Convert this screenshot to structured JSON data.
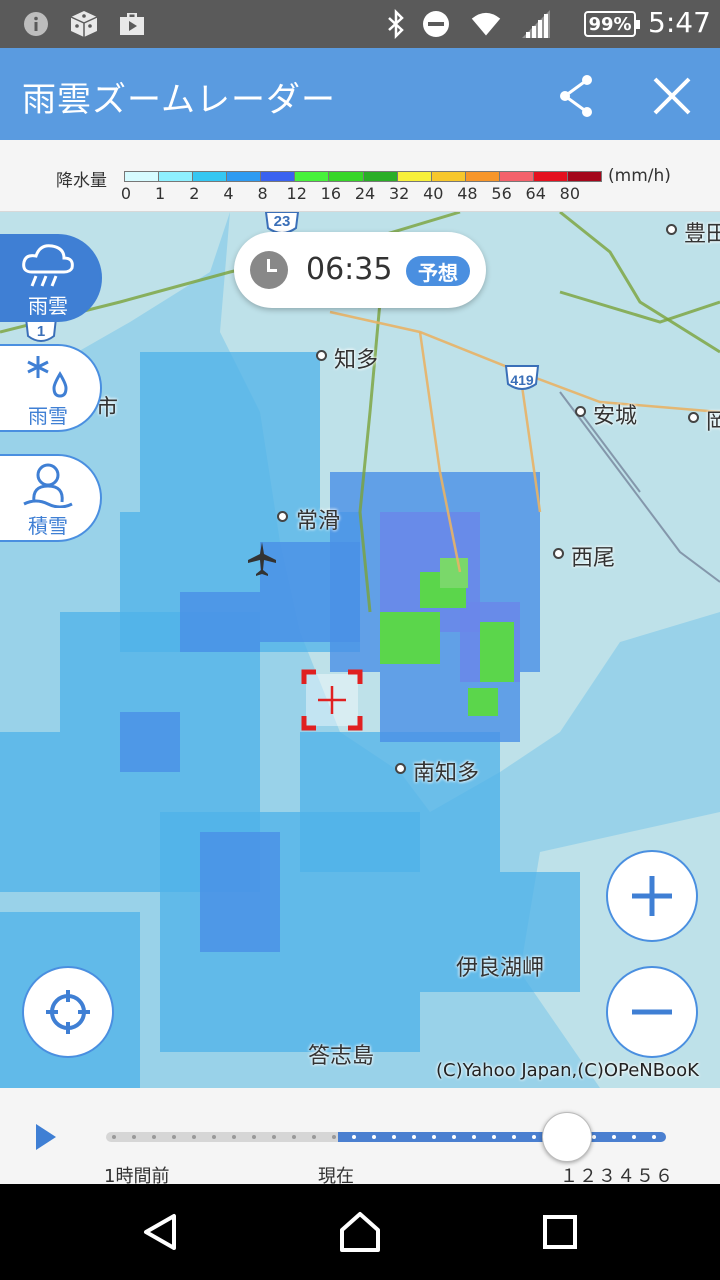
{
  "status_bar": {
    "icons": [
      "info-icon",
      "dice-icon",
      "play-store-icon",
      "bluetooth-icon",
      "do-not-disturb-icon",
      "wifi-icon",
      "signal-icon"
    ],
    "battery": "99%",
    "time": "5:47"
  },
  "app_bar": {
    "title": "雨雲ズームレーダー",
    "icons": [
      "share-icon",
      "close-icon"
    ]
  },
  "legend": {
    "label": "降水量",
    "ticks": [
      "0",
      "1",
      "2",
      "4",
      "8",
      "12",
      "16",
      "24",
      "32",
      "40",
      "48",
      "56",
      "64",
      "80"
    ],
    "unit": "(mm/h)",
    "colors": [
      "#d6fbff",
      "#8ef0ff",
      "#35c7f2",
      "#2e9bf2",
      "#3a62f0",
      "#47f23c",
      "#37d629",
      "#2aae27",
      "#f7f03a",
      "#f7c72c",
      "#f7962a",
      "#f4616b",
      "#e4101e",
      "#a4061a"
    ]
  },
  "map": {
    "time": "06:35",
    "badge": "予想",
    "modes": [
      {
        "label": "雨雲",
        "icon": "rain-cloud-icon",
        "active": true
      },
      {
        "label": "雨雪",
        "icon": "snow-rain-icon",
        "active": false
      },
      {
        "label": "積雪",
        "icon": "snowman-icon",
        "active": false
      }
    ],
    "places": {
      "chita": "知多",
      "anjo": "安城",
      "toyota": "豊田",
      "tokoname": "常滑",
      "nishio": "西尾",
      "minamichita": "南知多",
      "irago": "伊良湖岬",
      "toshijima": "答志島",
      "edge_right": "岡",
      "edge_left": "市"
    },
    "route_labels": [
      "23",
      "1",
      "419"
    ],
    "credit": "(C)Yahoo Japan,(C)OPeNBooK",
    "buttons": [
      "zoom-in-icon",
      "zoom-out-icon",
      "current-location-icon"
    ]
  },
  "timeline": {
    "label_past": "1時間前",
    "label_now": "現在",
    "label_future": "１２３４５６"
  },
  "nav_bar": {
    "icons": [
      "back-icon",
      "home-icon",
      "recents-icon"
    ]
  }
}
